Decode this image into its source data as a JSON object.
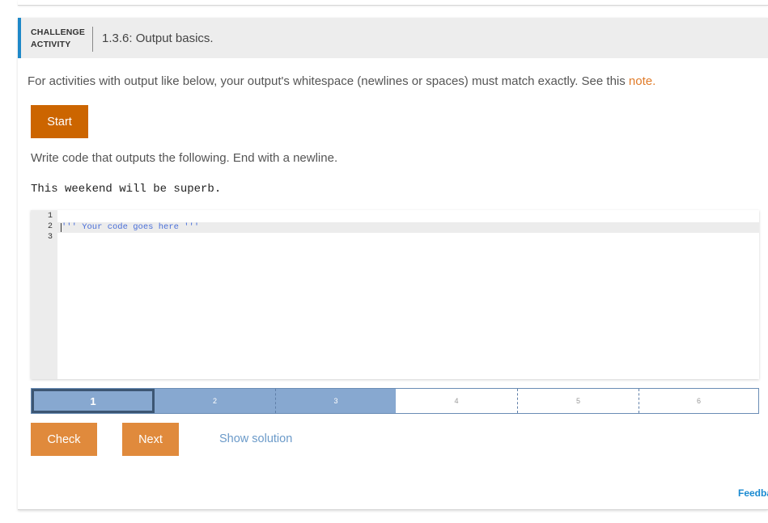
{
  "header": {
    "badge_line1": "CHALLENGE",
    "badge_line2": "ACTIVITY",
    "title": "1.3.6: Output basics.",
    "accent_color": "#1e88c8"
  },
  "intro": {
    "text": "For activities with output like below, your output's whitespace (newlines or spaces) must match exactly. See this ",
    "link_label": "note",
    "trailing": "."
  },
  "start_label": "Start",
  "instruction": "Write code that outputs the following. End with a newline.",
  "expected_output": "This weekend will be superb.",
  "editor": {
    "line_numbers": [
      "1",
      "2",
      "3"
    ],
    "code_line_2": "''' Your code goes here '''"
  },
  "progress": {
    "current": "1",
    "steps": [
      "1",
      "2",
      "3",
      "4",
      "5",
      "6"
    ],
    "completed_count": 3
  },
  "buttons": {
    "check": "Check",
    "next": "Next",
    "show_solution": "Show solution"
  },
  "feedback_label": "Feedback?",
  "colors": {
    "start": "#cc6500",
    "action": "#e08a3c",
    "link": "#e07b29",
    "progress_done": "#87a8d0"
  }
}
